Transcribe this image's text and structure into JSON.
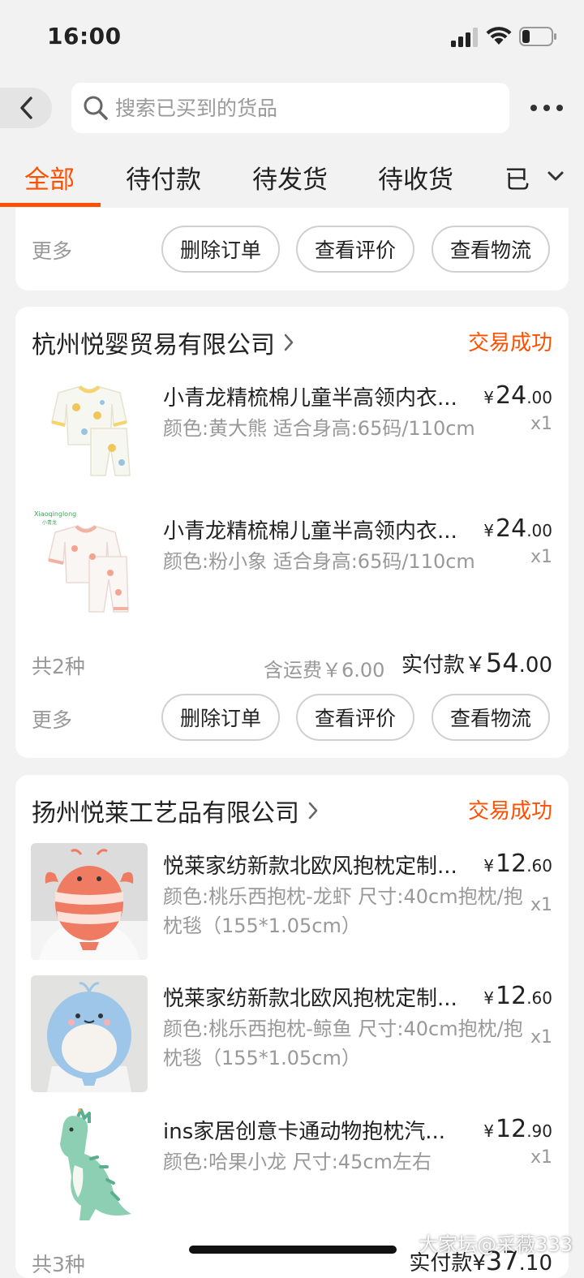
{
  "status_bar": {
    "time": "16:00"
  },
  "search": {
    "placeholder": "搜索已买到的货品"
  },
  "tabs": [
    {
      "label": "全部",
      "active": true
    },
    {
      "label": "待付款"
    },
    {
      "label": "待发货"
    },
    {
      "label": "待收货"
    },
    {
      "label": "已"
    }
  ],
  "actions": {
    "more": "更多",
    "delete": "删除订单",
    "review": "查看评价",
    "logistics": "查看物流"
  },
  "orders": [
    {
      "shop": "杭州悦婴贸易有限公司",
      "status": "交易成功",
      "items": [
        {
          "title": "小青龙精梳棉儿童半高领内衣...",
          "spec": "颜色:黄大熊 适合身高:65码/110cm",
          "currency": "¥",
          "price_int": "24",
          "price_dec": ".00",
          "qty": "x1"
        },
        {
          "title": "小青龙精梳棉儿童半高领内衣...",
          "spec": "颜色:粉小象 适合身高:65码/110cm",
          "currency": "¥",
          "price_int": "24",
          "price_dec": ".00",
          "qty": "x1",
          "brand": "Xiaoqinglong",
          "brand_cn": "小青龙"
        }
      ],
      "count": "共2种",
      "shipping": "含运费￥6.00",
      "paid_label": "实付款",
      "paid_currency": "￥",
      "paid_int": "54",
      "paid_dec": ".00"
    },
    {
      "shop": "扬州悦莱工艺品有限公司",
      "status": "交易成功",
      "items": [
        {
          "title": "悦莱家纺新款北欧风抱枕定制...",
          "spec": "颜色:桃乐西抱枕-龙虾 尺寸:40cm抱枕/抱枕毯（155*1.05cm）",
          "currency": "¥",
          "price_int": "12",
          "price_dec": ".60",
          "qty": "x1"
        },
        {
          "title": "悦莱家纺新款北欧风抱枕定制...",
          "spec": "颜色:桃乐西抱枕-鲸鱼 尺寸:40cm抱枕/抱枕毯（155*1.05cm）",
          "currency": "¥",
          "price_int": "12",
          "price_dec": ".60",
          "qty": "x1"
        },
        {
          "title": "ins家居创意卡通动物抱枕汽...",
          "spec": "颜色:哈果小龙 尺寸:45cm左右",
          "currency": "¥",
          "price_int": "12",
          "price_dec": ".90",
          "qty": "x1"
        }
      ],
      "count": "共3种",
      "paid_label": "实付款",
      "paid_currency": "¥",
      "paid_int": "37",
      "paid_dec": ".10"
    }
  ],
  "watermark": "大家坛@采薇333",
  "colors": {
    "accent": "#ff5000",
    "background": "#f2f2f2",
    "muted_text": "#999999"
  }
}
